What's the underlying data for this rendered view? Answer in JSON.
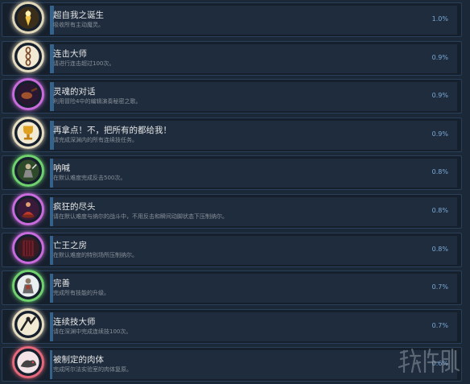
{
  "achievements": [
    {
      "title": "超自我之诞生",
      "desc": "吸收所有主动魔灵。",
      "pct": "1.0%",
      "pct_value": 1.0,
      "icon": "glowing-figure-icon",
      "ring": "#e0d6b8"
    },
    {
      "title": "连击大师",
      "desc": "请进行连击超过100次。",
      "pct": "0.9%",
      "pct_value": 0.9,
      "icon": "chain-icon",
      "ring": "#e6dcc0"
    },
    {
      "title": "灵魂的对话",
      "desc": "利用冒险4中的编辑演奏秘密之歌。",
      "pct": "0.9%",
      "pct_value": 0.9,
      "icon": "lute-icon",
      "ring": "#c86bdc"
    },
    {
      "title": "再拿点！不，把所有的都给我！",
      "desc": "请完成深渊内的所有连续技任务。",
      "pct": "0.9%",
      "pct_value": 0.9,
      "icon": "trophy-icon",
      "ring": "#e6dcc0"
    },
    {
      "title": "呐喊",
      "desc": "在默认难度完成反击500次。",
      "pct": "0.8%",
      "pct_value": 0.8,
      "icon": "warrior-icon",
      "ring": "#6fd26f"
    },
    {
      "title": "疯狂的尽头",
      "desc": "请在默认难度与纳尔的战斗中，不用反击和瞬间动脚状态下压制纳尔。",
      "pct": "0.8%",
      "pct_value": 0.8,
      "icon": "meditating-figure-icon",
      "ring": "#c86bdc"
    },
    {
      "title": "亡王之房",
      "desc": "在默认难度的特别场所压制纳尔。",
      "pct": "0.8%",
      "pct_value": 0.8,
      "icon": "door-icon",
      "ring": "#c86bdc"
    },
    {
      "title": "完善",
      "desc": "完成所有技能的升级。",
      "pct": "0.7%",
      "pct_value": 0.7,
      "icon": "armored-warrior-icon",
      "ring": "#6fd26f"
    },
    {
      "title": "连续技大师",
      "desc": "请在深渊中完成连续技100次。",
      "pct": "0.7%",
      "pct_value": 0.7,
      "icon": "combo-fighter-icon",
      "ring": "#e6dcc0"
    },
    {
      "title": "被制定的肉体",
      "desc": "完成阿尔法实验室的肉体复原。",
      "pct": "0.6%",
      "pct_value": 0.6,
      "icon": "creature-icon",
      "ring": "#e6687a"
    }
  ],
  "watermark": {
    "text": "游侠网"
  },
  "colors": {
    "background": "#1b2838",
    "bar_fill": "#35628a",
    "row_border": "#2a3f5a"
  }
}
